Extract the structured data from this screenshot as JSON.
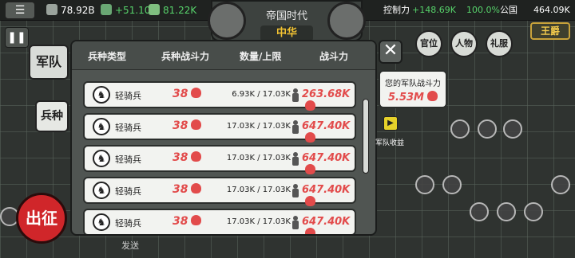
{
  "topbar": {
    "gold": "78.92B",
    "gold_rate": "+51.10K",
    "food": "81.22K",
    "control_label": "控制力",
    "control_delta": "+148.69K",
    "control_pct": "100.0%",
    "treasury_label": "公国",
    "treasury_value": "464.09K",
    "menu_icon": "menu-icon"
  },
  "banner": {
    "era": "帝国时代",
    "nation": "中华"
  },
  "left": {
    "army_tab": "军队",
    "unit_tab": "兵种",
    "attack_button": "出征",
    "pause_icon": "pause-icon"
  },
  "table": {
    "headers": [
      "兵种类型",
      "兵种战斗力",
      "数量/上限",
      "战斗力"
    ],
    "rows": [
      {
        "name": "轻骑兵",
        "power": "38",
        "qty": "6.93K / 17.03K",
        "total": "263.68K"
      },
      {
        "name": "轻骑兵",
        "power": "38",
        "qty": "17.03K / 17.03K",
        "total": "647.40K"
      },
      {
        "name": "轻骑兵",
        "power": "38",
        "qty": "17.03K / 17.03K",
        "total": "647.40K"
      },
      {
        "name": "轻骑兵",
        "power": "38",
        "qty": "17.03K / 17.03K",
        "total": "647.40K"
      },
      {
        "name": "轻骑兵",
        "power": "38",
        "qty": "17.03K / 17.03K",
        "total": "647.40K"
      }
    ]
  },
  "right": {
    "army_power_label": "您的军队战斗力",
    "army_power_value": "5.53M",
    "income_label": "军队收益",
    "officials": "官位",
    "people": "人物",
    "ceremony": "礼服",
    "rank": "王爵"
  },
  "bottom": {
    "send": "发送"
  },
  "colors": {
    "accent_red": "#e24b4b",
    "attack_red": "#d0262a",
    "gold_text": "#f1c232"
  }
}
